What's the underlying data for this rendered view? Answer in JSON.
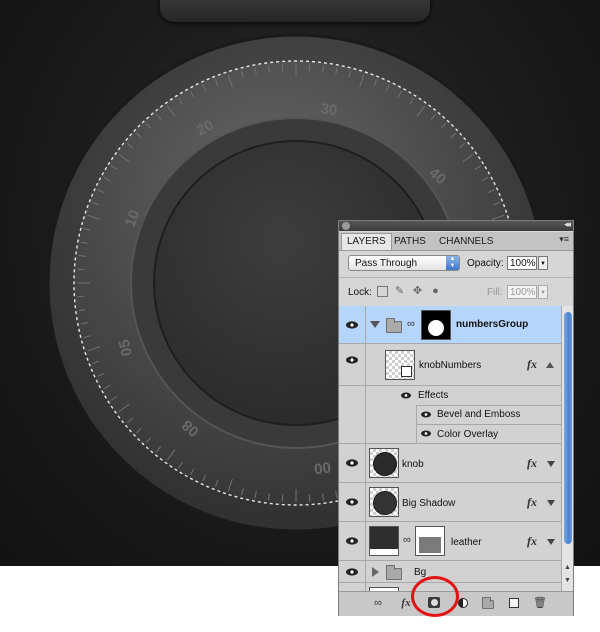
{
  "canvas": {
    "dial_numbers": [
      "20",
      "30",
      "40",
      "10",
      "05",
      "08",
      "00"
    ]
  },
  "layers_panel": {
    "tabs": [
      {
        "label": "LAYERS",
        "active": true
      },
      {
        "label": "PATHS",
        "active": false
      },
      {
        "label": "CHANNELS",
        "active": false
      }
    ],
    "blend_mode": "Pass Through",
    "opacity_label": "Opacity:",
    "opacity_value": "100%",
    "lock_label": "Lock:",
    "fill_label": "Fill:",
    "fill_value": "100%",
    "layers": [
      {
        "name": "numbersGroup",
        "type": "group",
        "selected": true,
        "expanded": true
      },
      {
        "name": "knobNumbers",
        "type": "layer",
        "fx": "fx",
        "effects_label": "Effects",
        "effects": [
          "Bevel and Emboss",
          "Color Overlay"
        ]
      },
      {
        "name": "knob",
        "type": "layer",
        "fx": "fx"
      },
      {
        "name": "Big Shadow",
        "type": "layer",
        "fx": "fx"
      },
      {
        "name": "leather",
        "type": "layer",
        "fx": "fx"
      },
      {
        "name": "Bg",
        "type": "group",
        "expanded": false
      }
    ],
    "bottom_icons": [
      "link-icon",
      "fx-icon",
      "add-mask-icon",
      "adjustment-icon",
      "new-group-icon",
      "new-layer-icon",
      "trash-icon"
    ],
    "highlight_color": "#e21313",
    "selection_color": "#b5d5fb"
  }
}
